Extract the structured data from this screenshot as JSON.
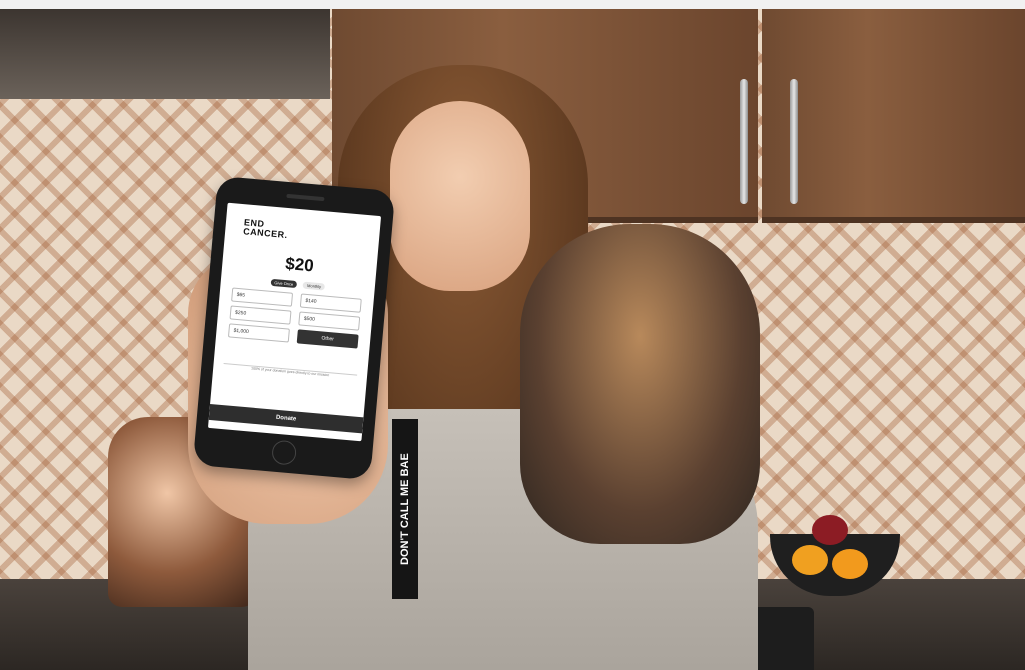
{
  "donation_app": {
    "logo_line1": "END",
    "logo_line2": "CANCER.",
    "amount": "$20",
    "frequency": {
      "options": [
        "Give Once",
        "Monthly"
      ],
      "selected": "Give Once"
    },
    "amount_options": [
      "$65",
      "$140",
      "$250",
      "$500",
      "$1,000",
      "Other"
    ],
    "selected_option": "Other",
    "note_text": "100% of your donation goes directly to our mission",
    "donate_label": "Donate"
  },
  "lanyard_text": "DON'T CALL ME BAE",
  "colors": {
    "tile_base": "#ead9c6",
    "tile_pattern": "#a05a32",
    "cabinet": "#8a5e3f",
    "phone_body": "#1a1a1a",
    "button_dark": "#2e2e2e"
  }
}
